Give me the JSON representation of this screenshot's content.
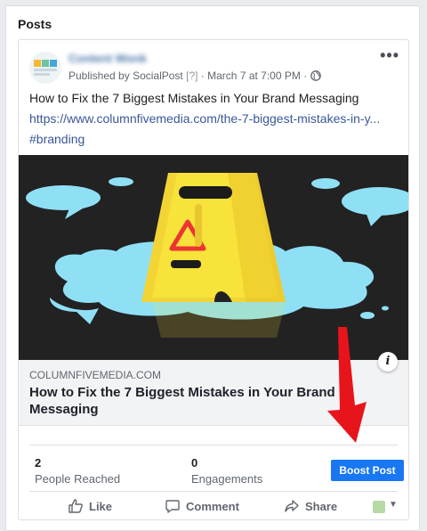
{
  "section": {
    "title": "Posts"
  },
  "post": {
    "author": "Content Wonk",
    "published_by_prefix": "Published by",
    "publisher": "SocialPost",
    "publisher_badge": "[?]",
    "separator": "·",
    "date": "March 7 at 7:00 PM",
    "more_icon": "•••",
    "text": "How to Fix the 7 Biggest Mistakes in Your Brand Messaging",
    "link_url": "https://www.columnfivemedia.com/the-7-biggest-mistakes-in-y...",
    "hashtag": "#branding",
    "image_desc_icon": "wet-floor-sign-illustration",
    "link_preview": {
      "domain": "COLUMNFIVEMEDIA.COM",
      "title": "How to Fix the 7 Biggest Mistakes in Your Brand Messaging",
      "info_icon": "i"
    }
  },
  "stats": {
    "reached_value": "2",
    "reached_label": "People Reached",
    "engagements_value": "0",
    "engagements_label": "Engagements",
    "boost_label": "Boost Post"
  },
  "actions": {
    "like": "Like",
    "comment": "Comment",
    "share": "Share"
  },
  "colors": {
    "link": "#385898",
    "boost": "#1877f2",
    "annotation_arrow": "#e8141b",
    "image_bg": "#222222",
    "puddle": "#8fe0f5",
    "sign": "#f7e33a"
  }
}
